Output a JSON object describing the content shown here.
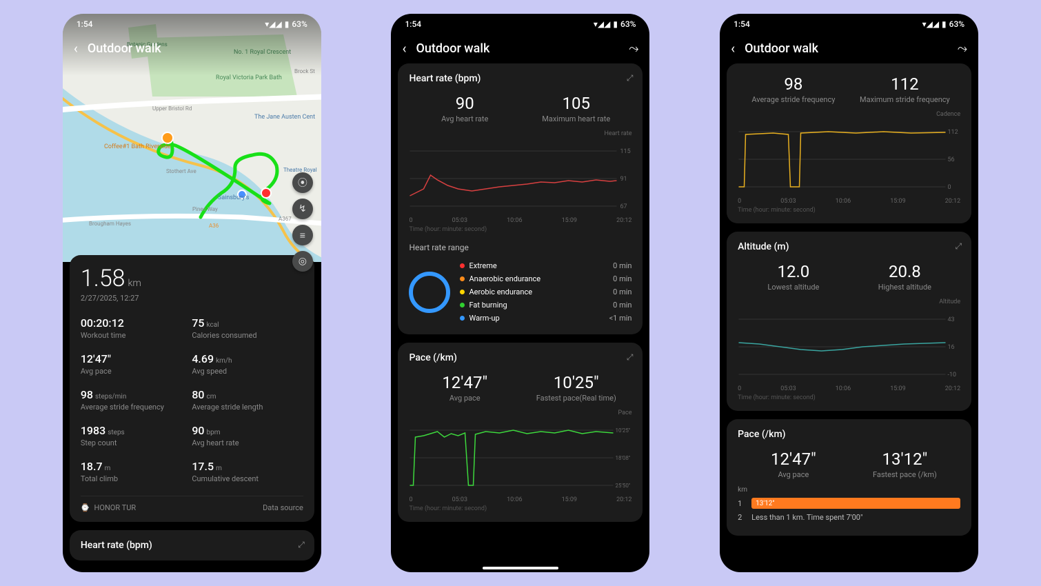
{
  "status_bar": {
    "time": "1:54",
    "battery": "63%"
  },
  "header": {
    "title": "Outdoor walk"
  },
  "map": {
    "labels": [
      "No. 1 Royal Crescent",
      "Royal Victoria Park Bath",
      "Brock St",
      "Upper Bristol Rd",
      "The Jane Austen Cent",
      "Coffee#1 Bath Riverside",
      "Stothert Ave",
      "Theatre Royal",
      "Sainsbury's",
      "Pines Way",
      "A367",
      "A36",
      "Brougham Hayes",
      "Botanic Gardens"
    ]
  },
  "summary": {
    "distance": "1.58",
    "distance_unit": "km",
    "datetime": "2/27/2025, 12:27",
    "stats": [
      {
        "val": "00:20:12",
        "unit": "",
        "lbl": "Workout time"
      },
      {
        "val": "75",
        "unit": "kcal",
        "lbl": "Calories consumed"
      },
      {
        "val": "12'47\"",
        "unit": "",
        "lbl": "Avg pace"
      },
      {
        "val": "4.69",
        "unit": "km/h",
        "lbl": "Avg speed"
      },
      {
        "val": "98",
        "unit": "steps/min",
        "lbl": "Average stride frequency"
      },
      {
        "val": "80",
        "unit": "cm",
        "lbl": "Average stride length"
      },
      {
        "val": "1983",
        "unit": "steps",
        "lbl": "Step count"
      },
      {
        "val": "90",
        "unit": "bpm",
        "lbl": "Avg heart rate"
      },
      {
        "val": "18.7",
        "unit": "m",
        "lbl": "Total climb"
      },
      {
        "val": "17.5",
        "unit": "m",
        "lbl": "Cumulative descent"
      }
    ],
    "device": "HONOR TUR",
    "data_source": "Data source"
  },
  "hr_card": {
    "title": "Heart rate (bpm)",
    "avg": "90",
    "avg_lbl": "Avg heart rate",
    "max": "105",
    "max_lbl": "Maximum heart rate",
    "ylabel": "Heart rate",
    "yticks": [
      "115",
      "91",
      "67"
    ],
    "range_title": "Heart rate range",
    "zones": [
      {
        "color": "#ff3030",
        "name": "Extreme",
        "val": "0 min"
      },
      {
        "color": "#ff8c1a",
        "name": "Anaerobic endurance",
        "val": "0 min"
      },
      {
        "color": "#ffd500",
        "name": "Aerobic endurance",
        "val": "0 min"
      },
      {
        "color": "#30d030",
        "name": "Fat burning",
        "val": "0 min"
      },
      {
        "color": "#3498ff",
        "name": "Warm-up",
        "val": "<1 min"
      }
    ]
  },
  "pace_card": {
    "title": "Pace (/km)",
    "avg": "12'47\"",
    "avg_lbl": "Avg pace",
    "fast": "10'25\"",
    "fast_lbl": "Fastest pace(Real time)",
    "ylabel": "Pace",
    "yticks": [
      "10'25\"",
      "18'08\"",
      "25'50\""
    ]
  },
  "stride_card": {
    "avg": "98",
    "avg_lbl": "Average stride frequency",
    "max": "112",
    "max_lbl": "Maximum stride frequency",
    "ylabel": "Cadence",
    "yticks": [
      "112",
      "56",
      "0"
    ]
  },
  "alt_card": {
    "title": "Altitude (m)",
    "low": "12.0",
    "low_lbl": "Lowest altitude",
    "high": "20.8",
    "high_lbl": "Highest altitude",
    "ylabel": "Altitude",
    "yticks": [
      "43",
      "16",
      "-10"
    ]
  },
  "pace2_card": {
    "title": "Pace (/km)",
    "avg": "12'47\"",
    "avg_lbl": "Avg pace",
    "fast": "13'12\"",
    "fast_lbl": "Fastest pace (/km)",
    "km_label": "km",
    "rows": [
      {
        "idx": "1",
        "bar_text": "13'12\"",
        "full": true
      },
      {
        "idx": "2",
        "text": "Less than 1 km. Time spent 7'00\"",
        "full": false
      }
    ]
  },
  "xticks": [
    "0",
    "05:03",
    "10:06",
    "15:09",
    "20:12"
  ],
  "time_axis_label": "Time (hour: minute: second)",
  "chart_data": [
    {
      "type": "line",
      "title": "Heart rate (bpm)",
      "x_ms": [
        0,
        303,
        606,
        909,
        1212
      ],
      "xticks": [
        "0",
        "05:03",
        "10:06",
        "15:09",
        "20:12"
      ],
      "yticks": [
        115,
        91,
        67
      ],
      "ylabel": "Heart rate",
      "series": [
        {
          "name": "Heart rate",
          "color": "#d84040",
          "values": [
            78,
            80,
            85,
            98,
            93,
            88,
            86,
            84,
            85,
            86,
            88,
            90,
            91,
            89,
            90,
            92,
            91,
            90,
            92,
            91
          ]
        }
      ]
    },
    {
      "type": "line",
      "title": "Pace (/km)",
      "xticks": [
        "0",
        "05:03",
        "10:06",
        "15:09",
        "20:12"
      ],
      "yticks": [
        "10'25\"",
        "18'08\"",
        "25'50\""
      ],
      "ylabel": "Pace",
      "series": [
        {
          "name": "Pace",
          "color": "#3dd83d",
          "values": [
            25.5,
            12,
            11,
            10.5,
            11,
            11,
            25.5,
            11,
            10.5,
            11,
            11,
            10.5,
            11,
            11,
            10.5,
            11,
            11,
            11,
            11,
            10.5
          ]
        }
      ],
      "note": "lower value = faster; dips to 25'50\" at start and ~30% mark"
    },
    {
      "type": "line",
      "title": "Cadence",
      "xticks": [
        "0",
        "05:03",
        "10:06",
        "15:09",
        "20:12"
      ],
      "yticks": [
        112,
        56,
        0
      ],
      "ylabel": "Cadence",
      "series": [
        {
          "name": "Cadence",
          "color": "#e8b020",
          "values": [
            0,
            108,
            108,
            106,
            108,
            0,
            0,
            108,
            110,
            110,
            110,
            108,
            110,
            108,
            108,
            108,
            108,
            108,
            110,
            108
          ]
        }
      ]
    },
    {
      "type": "line",
      "title": "Altitude (m)",
      "xticks": [
        "0",
        "05:03",
        "10:06",
        "15:09",
        "20:12"
      ],
      "yticks": [
        43,
        16,
        -10
      ],
      "ylabel": "Altitude",
      "series": [
        {
          "name": "Altitude",
          "color": "#3aa5a0",
          "values": [
            20,
            19,
            18,
            17,
            16,
            15,
            14,
            13,
            13,
            14,
            16,
            17,
            17,
            16,
            16,
            17,
            18,
            18,
            19,
            19
          ]
        }
      ]
    }
  ]
}
